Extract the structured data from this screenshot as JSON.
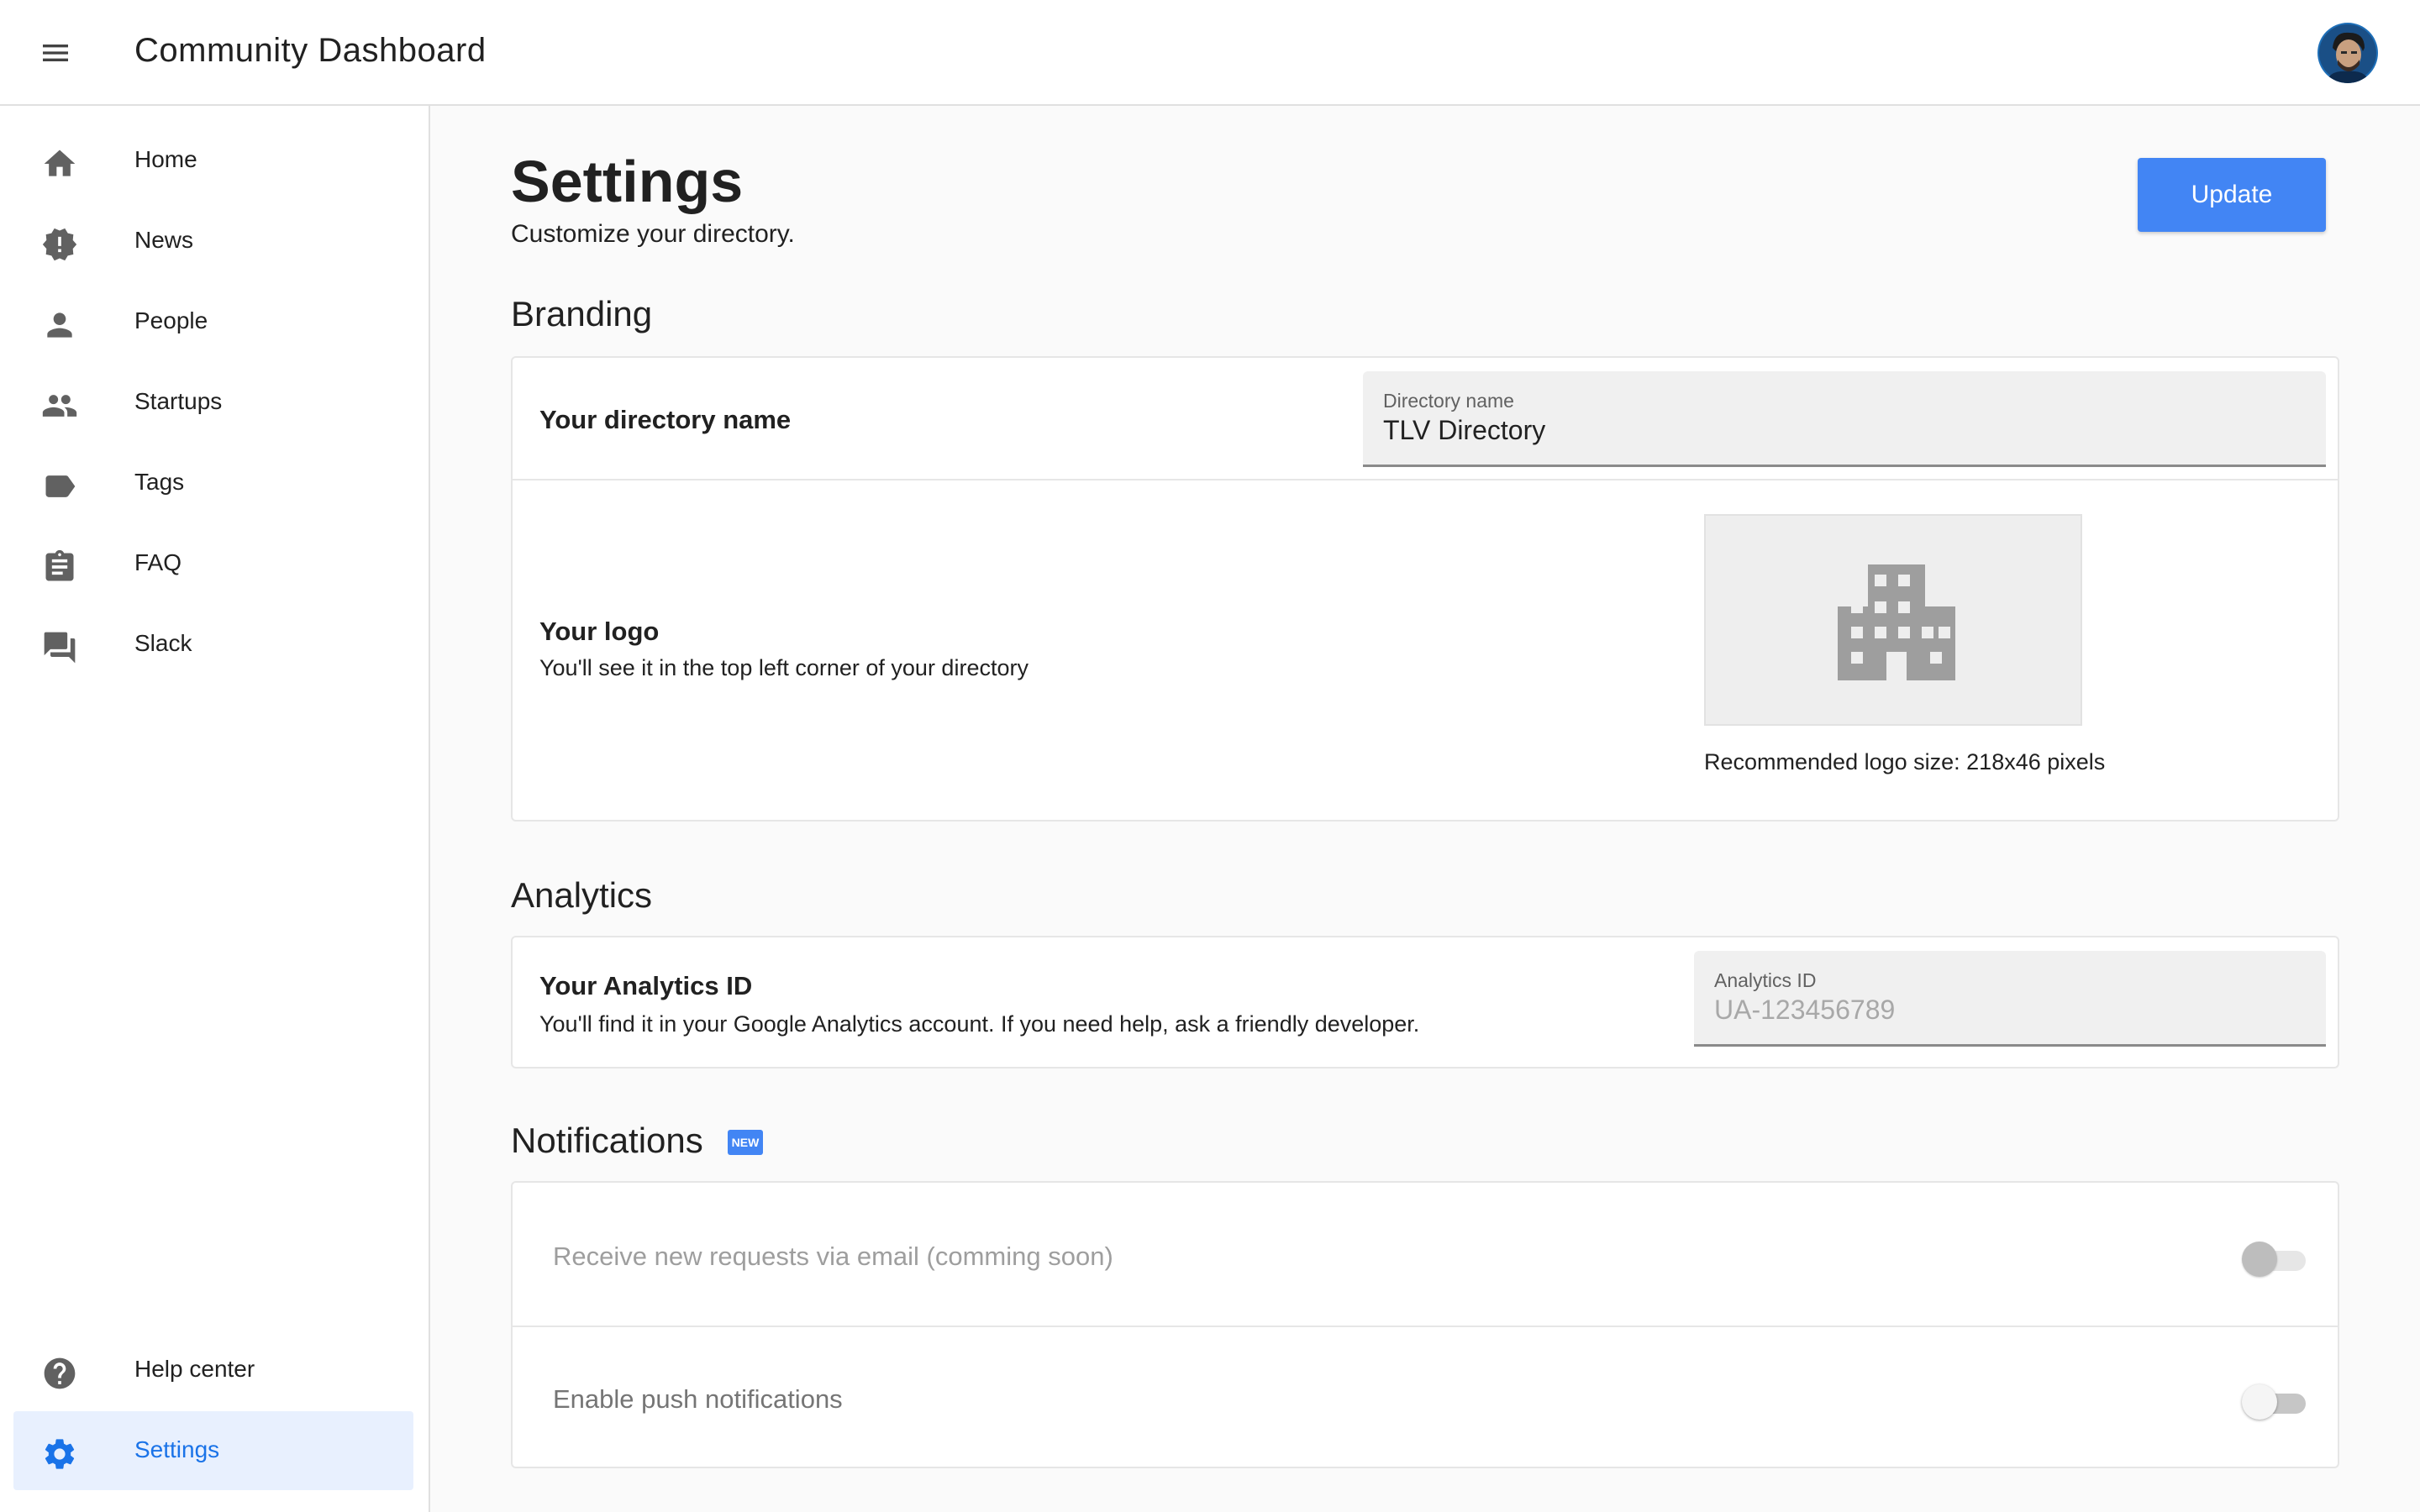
{
  "app": {
    "title": "Community Dashboard",
    "menu_icon": "menu-icon",
    "avatar_icon": "user-avatar"
  },
  "sidebar": {
    "items": [
      {
        "label": "Home",
        "icon": "home-icon"
      },
      {
        "label": "News",
        "icon": "news-badge-icon"
      },
      {
        "label": "People",
        "icon": "person-icon"
      },
      {
        "label": "Startups",
        "icon": "group-icon"
      },
      {
        "label": "Tags",
        "icon": "tag-icon"
      },
      {
        "label": "FAQ",
        "icon": "clipboard-icon"
      },
      {
        "label": "Slack",
        "icon": "chat-icon"
      }
    ],
    "bottom_items": [
      {
        "label": "Help center",
        "icon": "help-icon",
        "active": false
      },
      {
        "label": "Settings",
        "icon": "gear-icon",
        "active": true
      }
    ],
    "active_color": "#1a73e8",
    "active_bg": "#e8f0fe"
  },
  "page": {
    "title": "Settings",
    "subtitle": "Customize your directory.",
    "update_label": "Update",
    "accent_color": "#4285f4"
  },
  "branding": {
    "section_title": "Branding",
    "directory_name": {
      "title": "Your directory name",
      "field_label": "Directory name",
      "field_value": "TLV Directory"
    },
    "logo": {
      "title": "Your logo",
      "description": "You'll see it in the top left corner of your directory",
      "placeholder_icon": "building-icon",
      "hint": "Recommended logo size: 218x46 pixels"
    }
  },
  "analytics": {
    "section_title": "Analytics",
    "title": "Your Analytics ID",
    "description": "You'll find it in your Google Analytics account. If you need help, ask a friendly developer.",
    "field_label": "Analytics ID",
    "field_value": "",
    "field_placeholder": "UA-123456789"
  },
  "notifications": {
    "section_title": "Notifications",
    "badge": "NEW",
    "items": [
      {
        "label": "Receive new requests via email (comming soon)",
        "enabled": false,
        "on": false
      },
      {
        "label": "Enable push notifications",
        "enabled": true,
        "on": false
      }
    ]
  }
}
